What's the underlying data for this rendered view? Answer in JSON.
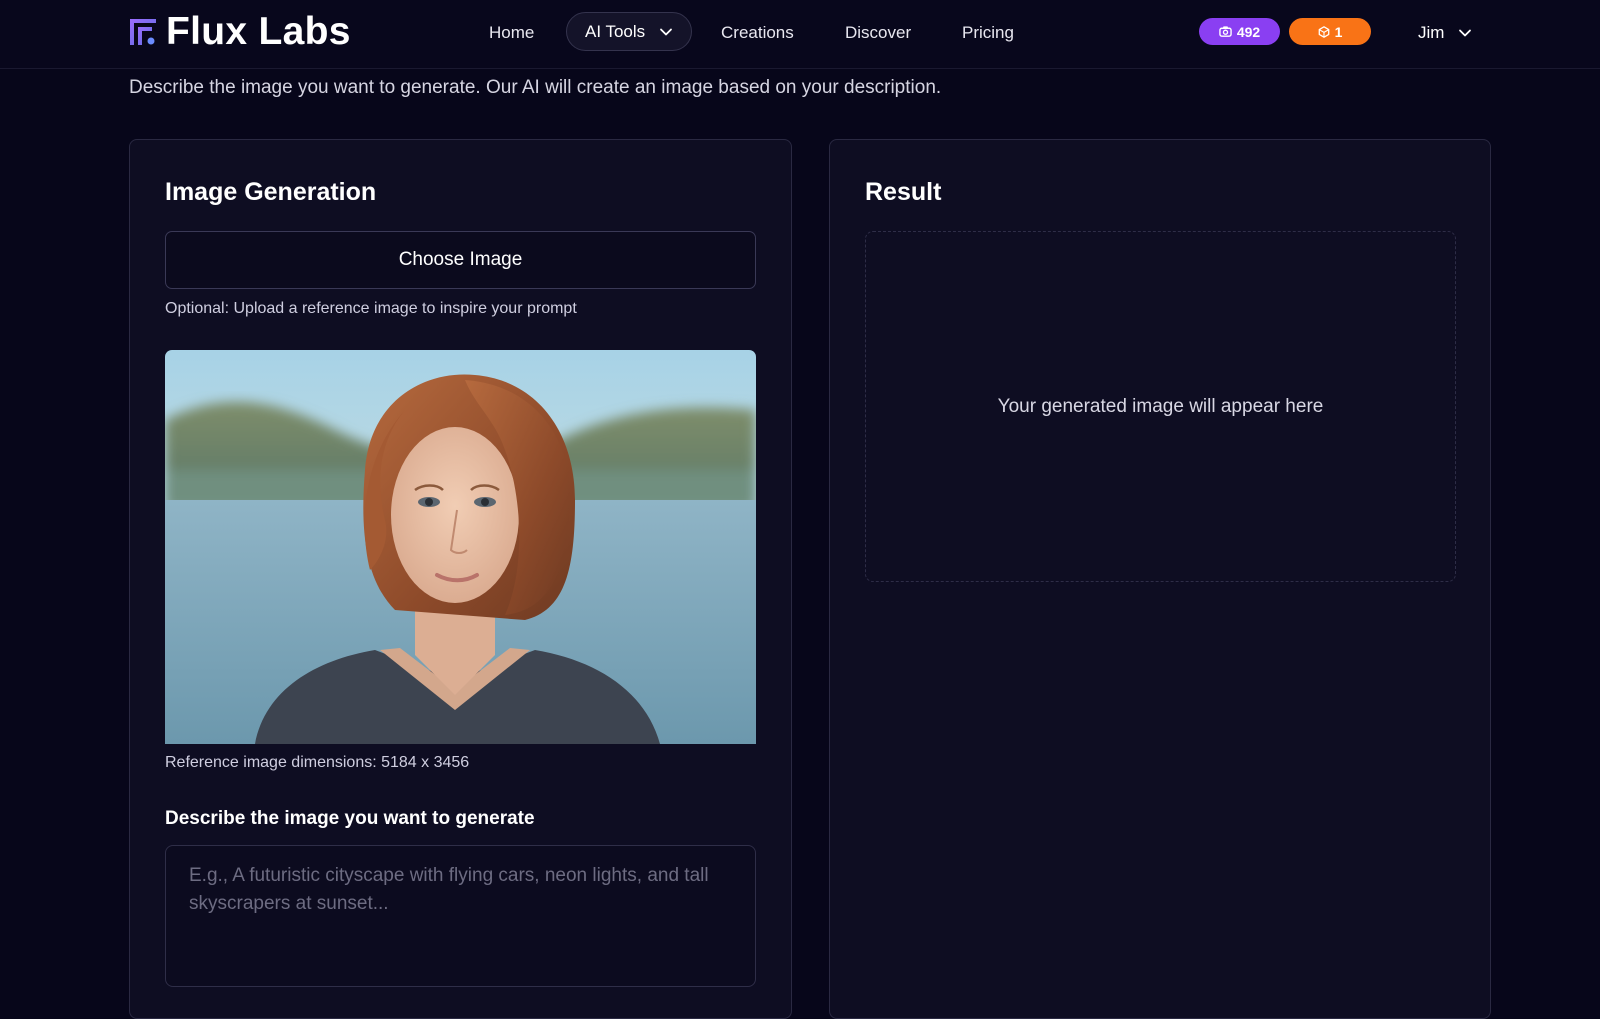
{
  "brand": {
    "name": "Flux Labs",
    "logo_icon": "flux-logo-icon",
    "accent_gradient": [
      "#8a5cf6",
      "#6b6bd6"
    ]
  },
  "nav": {
    "home": "Home",
    "ai_tools": "AI Tools",
    "creations": "Creations",
    "discover": "Discover",
    "pricing": "Pricing"
  },
  "badges": {
    "credits": {
      "value": "492",
      "icon": "camera-icon",
      "color": "#8a3ff2"
    },
    "gems": {
      "value": "1",
      "icon": "gem-icon",
      "color": "#f97316"
    }
  },
  "user": {
    "name": "Jim"
  },
  "intro": "Describe the image you want to generate. Our AI will create an image based on your description.",
  "generation": {
    "title": "Image Generation",
    "choose_label": "Choose Image",
    "choose_hint": "Optional: Upload a reference image to inspire your prompt",
    "reference_dims": "Reference image dimensions: 5184 x 3456",
    "prompt_label": "Describe the image you want to generate",
    "prompt_placeholder": "E.g., A futuristic cityscape with flying cars, neon lights, and tall skyscrapers at sunset..."
  },
  "result": {
    "title": "Result",
    "empty_text": "Your generated image will appear here"
  }
}
